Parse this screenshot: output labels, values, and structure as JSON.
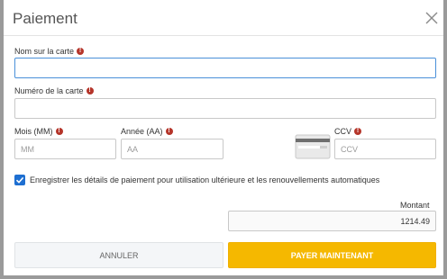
{
  "dialog": {
    "title": "Paiement",
    "close_icon": "close-icon"
  },
  "fields": {
    "card_name": {
      "label": "Nom sur la carte",
      "value": "",
      "placeholder": ""
    },
    "card_number": {
      "label": "Numéro de la carte",
      "value": "",
      "placeholder": ""
    },
    "month": {
      "label": "Mois (MM)",
      "value": "",
      "placeholder": "MM"
    },
    "year": {
      "label": "Année (AA)",
      "value": "",
      "placeholder": "AA"
    },
    "ccv": {
      "label": "CCV",
      "value": "",
      "placeholder": "CCV"
    },
    "required_icon": "exclamation-icon"
  },
  "save_details": {
    "checked": true,
    "label": "Enregistrer les détails de paiement pour utilisation ultérieure et les renouvellements automatiques"
  },
  "amount": {
    "label": "Montant",
    "value": "1214.49"
  },
  "buttons": {
    "cancel": "ANNULER",
    "pay": "PAYER MAINTENANT"
  },
  "colors": {
    "pay_button": "#f5b800",
    "required_icon": "#b5352a",
    "checkbox": "#1e6fd1",
    "focus_border": "#4a90d9"
  }
}
